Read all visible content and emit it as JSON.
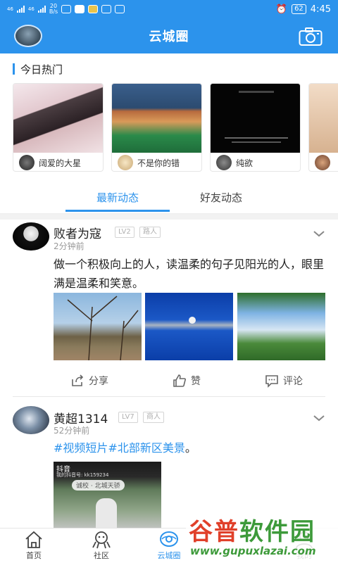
{
  "status_bar": {
    "signal1_label": "46",
    "signal2_label": "46",
    "speed_value": "20",
    "speed_unit": "B/s",
    "battery": "62",
    "time": "4:45"
  },
  "header": {
    "title": "云城圈"
  },
  "hot": {
    "title": "今日热门",
    "cards": [
      {
        "name": "阔爱的大星"
      },
      {
        "name": "不是你的错"
      },
      {
        "name": "纯欲"
      },
      {
        "name": ""
      }
    ]
  },
  "tabs": [
    {
      "label": "最新动态",
      "active": true
    },
    {
      "label": "好友动态",
      "active": false
    }
  ],
  "posts": [
    {
      "username": "败者为寇",
      "level": "LV2",
      "tag": "路人",
      "time": "2分钟前",
      "text": "做一个积极向上的人，读温柔的句子见阳光的人，眼里满是温柔和笑意。",
      "actions": {
        "share": "分享",
        "like": "赞",
        "comment": "评论"
      }
    },
    {
      "username": "黄超1314",
      "level": "LV7",
      "tag": "商人",
      "time": "52分钟前",
      "topic1": "#视频短片",
      "topic2": "#北部新区美景",
      "text_tail": "。",
      "video_app": "抖音",
      "video_id": "我的抖音号: kk159234",
      "video_location": "诚校 · 北城天骄"
    }
  ],
  "bottom_nav": [
    {
      "label": "首页",
      "active": false
    },
    {
      "label": "社区",
      "active": false
    },
    {
      "label": "云城圈",
      "active": true
    },
    {
      "label": "我的",
      "active": false
    }
  ],
  "watermark": {
    "brand": "谷普软件园",
    "url": "www.gupuxlazai.com"
  },
  "colors": {
    "accent": "#2c93ec",
    "text": "#222222",
    "muted": "#999999"
  }
}
